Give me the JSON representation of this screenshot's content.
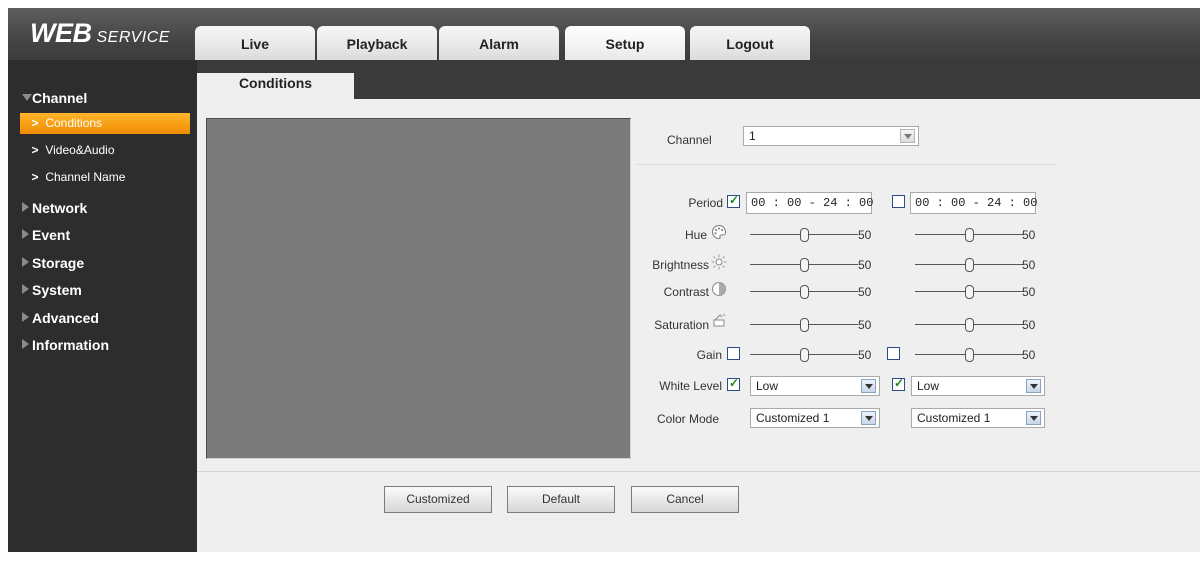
{
  "app": {
    "logo_main": "WEB",
    "logo_sub": "SERVICE"
  },
  "tabs": [
    {
      "label": "Live"
    },
    {
      "label": "Playback"
    },
    {
      "label": "Alarm"
    },
    {
      "label": "Setup",
      "active": true
    },
    {
      "label": "Logout"
    }
  ],
  "sidebar": {
    "groups": [
      {
        "label": "Channel",
        "expanded": true,
        "items": [
          {
            "label": "Conditions",
            "active": true
          },
          {
            "label": "Video&Audio"
          },
          {
            "label": "Channel Name"
          }
        ]
      },
      {
        "label": "Network"
      },
      {
        "label": "Event"
      },
      {
        "label": "Storage"
      },
      {
        "label": "System"
      },
      {
        "label": "Advanced"
      },
      {
        "label": "Information"
      }
    ]
  },
  "content_tab": "Conditions",
  "form": {
    "channel_label": "Channel",
    "channel_value": "1",
    "period_label": "Period",
    "period1": {
      "checked": true,
      "value": "00 : 00 - 24 : 00"
    },
    "period2": {
      "checked": false,
      "value": "00 : 00 - 24 : 00"
    },
    "hue_label": "Hue",
    "brightness_label": "Brightness",
    "contrast_label": "Contrast",
    "saturation_label": "Saturation",
    "gain_label": "Gain",
    "sliders": {
      "hue": [
        "50",
        "50"
      ],
      "brightness": [
        "50",
        "50"
      ],
      "contrast": [
        "50",
        "50"
      ],
      "saturation": [
        "50",
        "50"
      ],
      "gain": [
        "50",
        "50"
      ]
    },
    "gain1_checked": false,
    "gain2_checked": false,
    "white_level_label": "White Level",
    "white_level1": {
      "checked": true,
      "value": "Low"
    },
    "white_level2": {
      "checked": true,
      "value": "Low"
    },
    "color_mode_label": "Color Mode",
    "color_mode1": "Customized 1",
    "color_mode2": "Customized 1"
  },
  "buttons": {
    "customized": "Customized",
    "default": "Default",
    "cancel": "Cancel"
  },
  "colors": {
    "accent": "#f59a10",
    "sidebar_bg": "#2d2d2d",
    "content_bg": "#efefef"
  }
}
